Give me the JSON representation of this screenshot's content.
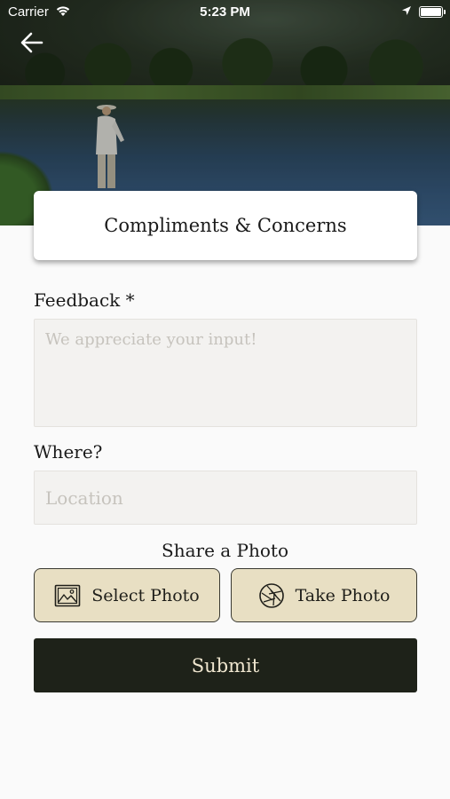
{
  "status_bar": {
    "carrier": "Carrier",
    "time": "5:23 PM",
    "battery_level": 1.0
  },
  "header": {
    "back_icon": "arrow-left-icon",
    "title": "Compliments & Concerns"
  },
  "form": {
    "feedback_label": "Feedback *",
    "feedback_placeholder": "We appreciate your input!",
    "feedback_value": "",
    "where_label": "Where?",
    "location_placeholder": "Location",
    "location_value": ""
  },
  "photo": {
    "share_label": "Share a Photo",
    "select_label": "Select Photo",
    "select_icon": "image-icon",
    "take_label": "Take Photo",
    "take_icon": "camera-aperture-icon"
  },
  "submit_label": "Submit",
  "colors": {
    "button_bg": "#e8dfc3",
    "submit_bg": "#1e2219",
    "submit_text": "#efe6cf",
    "field_bg": "#f3f2f0"
  }
}
